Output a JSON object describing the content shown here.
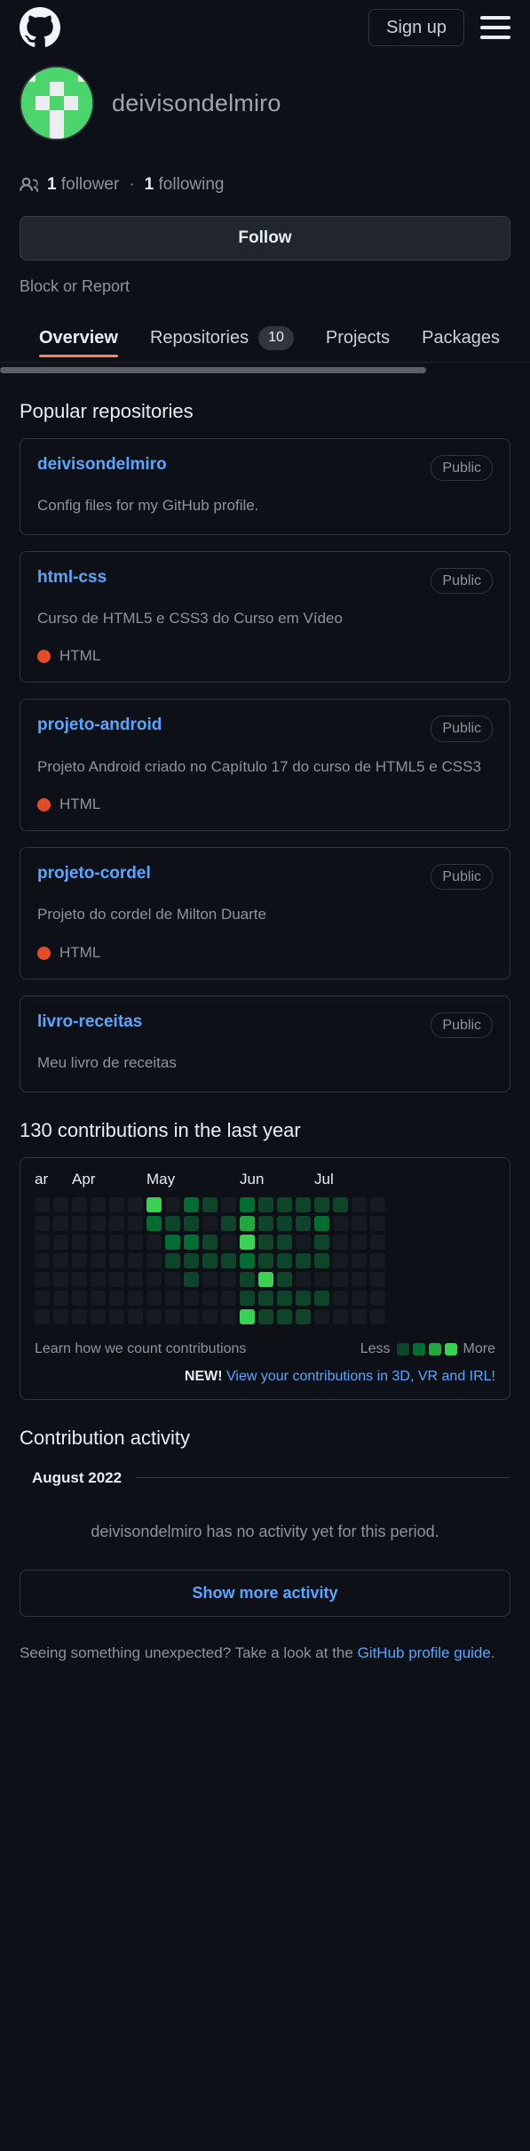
{
  "header": {
    "logo_icon": "github-mark-icon",
    "signup_label": "Sign up",
    "menu_icon": "hamburger-menu-icon"
  },
  "profile": {
    "avatar_icon": "identicon-avatar",
    "username": "deivisondelmiro",
    "people_icon": "people-icon",
    "followers_count": "1",
    "followers_label": "follower",
    "separator": "·",
    "following_count": "1",
    "following_label": "following",
    "follow_button": "Follow",
    "block_or_report": "Block or Report"
  },
  "nav": {
    "tabs": [
      {
        "label": "Overview",
        "count": null,
        "active": true
      },
      {
        "label": "Repositories",
        "count": "10",
        "active": false
      },
      {
        "label": "Projects",
        "count": null,
        "active": false
      },
      {
        "label": "Packages",
        "count": null,
        "active": false
      }
    ]
  },
  "popular_repositories": {
    "title": "Popular repositories",
    "items": [
      {
        "name": "deivisondelmiro",
        "visibility": "Public",
        "description": "Config files for my GitHub profile.",
        "language": null,
        "language_color": null
      },
      {
        "name": "html-css",
        "visibility": "Public",
        "description": "Curso de HTML5 e CSS3 do Curso em Vídeo",
        "language": "HTML",
        "language_color": "#e34c26"
      },
      {
        "name": "projeto-android",
        "visibility": "Public",
        "description": "Projeto Android criado no Capítulo 17 do curso de HTML5 e CSS3",
        "language": "HTML",
        "language_color": "#e34c26"
      },
      {
        "name": "projeto-cordel",
        "visibility": "Public",
        "description": "Projeto do cordel de Milton Duarte",
        "language": "HTML",
        "language_color": "#e34c26"
      },
      {
        "name": "livro-receitas",
        "visibility": "Public",
        "description": "Meu livro de receitas",
        "language": null,
        "language_color": null
      }
    ]
  },
  "contributions": {
    "heading": "130 contributions in the last year",
    "count": 130,
    "month_labels": [
      "ar",
      "Apr",
      "May",
      "Jun",
      "Jul"
    ],
    "learn_link": "Learn how we count contributions",
    "less_label": "Less",
    "more_label": "More",
    "new_badge": "NEW!",
    "new_link": "View your contributions in 3D, VR and IRL!",
    "level_colors": [
      "#161b22",
      "#0e4429",
      "#006d32",
      "#26a641",
      "#39d353"
    ],
    "legend_levels": [
      1,
      2,
      3,
      4
    ],
    "chart_data": {
      "type": "heatmap",
      "title": "130 contributions in the last year",
      "xlabel": "",
      "ylabel": "",
      "columns": 19,
      "rows": 7,
      "month_ticks": [
        {
          "label": "ar",
          "column": 0
        },
        {
          "label": "Apr",
          "column": 2
        },
        {
          "label": "May",
          "column": 6
        },
        {
          "label": "Jun",
          "column": 11
        },
        {
          "label": "Jul",
          "column": 15
        }
      ],
      "levels": [
        [
          0,
          0,
          0,
          0,
          0,
          0,
          4,
          0,
          2,
          1,
          0,
          2,
          1,
          1,
          1,
          1,
          1,
          0,
          0
        ],
        [
          0,
          0,
          0,
          0,
          0,
          0,
          2,
          1,
          1,
          0,
          1,
          3,
          1,
          1,
          1,
          2,
          0,
          0,
          0
        ],
        [
          0,
          0,
          0,
          0,
          0,
          0,
          0,
          2,
          2,
          1,
          0,
          4,
          1,
          1,
          0,
          1,
          0,
          0,
          0
        ],
        [
          0,
          0,
          0,
          0,
          0,
          0,
          0,
          1,
          1,
          1,
          1,
          2,
          1,
          1,
          1,
          1,
          0,
          0,
          0
        ],
        [
          0,
          0,
          0,
          0,
          0,
          0,
          0,
          0,
          1,
          0,
          0,
          1,
          4,
          1,
          0,
          0,
          0,
          0,
          0
        ],
        [
          0,
          0,
          0,
          0,
          0,
          0,
          0,
          0,
          0,
          0,
          0,
          1,
          1,
          1,
          1,
          1,
          0,
          0,
          0
        ],
        [
          0,
          0,
          0,
          0,
          0,
          0,
          0,
          0,
          0,
          0,
          0,
          4,
          1,
          1,
          1,
          0,
          0,
          0,
          0
        ]
      ]
    }
  },
  "activity": {
    "title": "Contribution activity",
    "month": "August 2022",
    "empty_message": "deivisondelmiro has no activity yet for this period.",
    "show_more_label": "Show more activity"
  },
  "footer": {
    "text_before": "Seeing something unexpected? Take a look at the ",
    "link_text": "GitHub profile guide",
    "text_after": "."
  }
}
